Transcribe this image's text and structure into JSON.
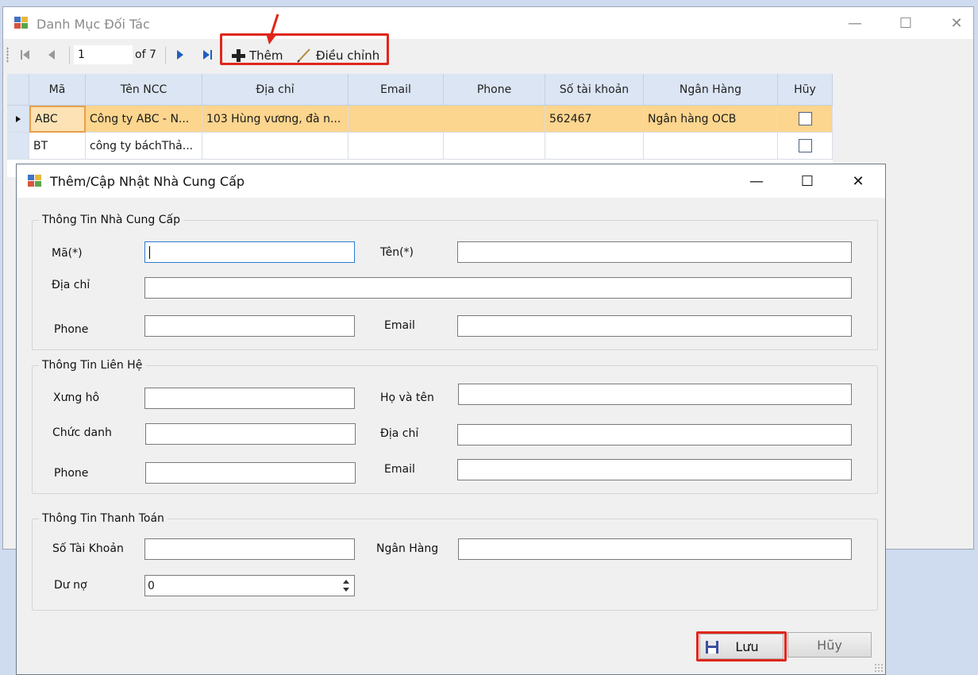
{
  "main_window": {
    "title": "Danh Mục Đối Tác",
    "controls": {
      "minimize": "—",
      "maximize": "☐",
      "close": "✕"
    }
  },
  "toolbar": {
    "position_value": "1",
    "count_label": "of 7",
    "add_label": "Thêm",
    "edit_label": "Điều chỉnh"
  },
  "grid": {
    "columns": [
      "Mã",
      "Tên NCC",
      "Địa chỉ",
      "Email",
      "Phone",
      "Số tài khoản",
      "Ngân Hàng",
      "Hũy"
    ],
    "rows": [
      {
        "ma": "ABC",
        "ten": "Công ty ABC - N...",
        "dia_chi": "103 Hùng vương, đà n...",
        "email": "",
        "phone": "",
        "stk": "562467",
        "ngan_hang": "Ngân hàng OCB",
        "selected": true
      },
      {
        "ma": "BT",
        "ten": "công ty báchThả...",
        "dia_chi": "",
        "email": "",
        "phone": "",
        "stk": "",
        "ngan_hang": "",
        "selected": false
      }
    ]
  },
  "dialog": {
    "title": "Thêm/Cập Nhật Nhà Cung Cấp",
    "controls": {
      "minimize": "—",
      "maximize": "☐",
      "close": "✕"
    },
    "group_supplier": {
      "legend": "Thông Tin Nhà Cung Cấp",
      "ma_label": "Mã(*)",
      "ten_label": "Tên(*)",
      "dia_chi_label": "Địa chỉ",
      "phone_label": "Phone",
      "email_label": "Email"
    },
    "group_contact": {
      "legend": "Thông Tin Liên Hệ",
      "xung_ho_label": "Xưng hô",
      "ho_ten_label": "Họ và tên",
      "chuc_danh_label": "Chức danh",
      "dia_chi_label": "Địa chỉ",
      "phone_label": "Phone",
      "email_label": "Email"
    },
    "group_payment": {
      "legend": "Thông Tin Thanh Toán",
      "stk_label": "Số Tài Khoản",
      "ngan_hang_label": "Ngân Hàng",
      "du_no_label": "Dư nợ",
      "du_no_value": "0"
    },
    "save_label": "Lưu",
    "cancel_label": "Hũy"
  },
  "colors": {
    "highlight_red": "#e0261b",
    "selected_row": "#fcd58e",
    "header_blue": "#dbe5f3"
  }
}
